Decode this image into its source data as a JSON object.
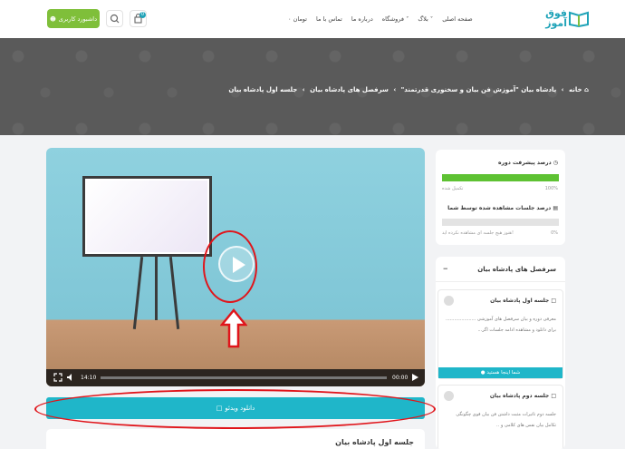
{
  "header": {
    "logo_text": "فوق آموز",
    "nav": [
      "صفحه اصلی",
      "بلاگ ˅",
      "فروشگاه ˅",
      "درباره ما",
      "تماس با ما",
      "۰ تومان"
    ],
    "dashboard_label": "داشبورد کاربری",
    "cart_count": "0"
  },
  "breadcrumb": {
    "items": [
      "خانه",
      "پادشاه بیان \"آموزش فن بیان و سخنوری قدرتمند\"",
      "سرفصل های پادشاه بیان",
      "جلسه اول پادشاه بیان"
    ],
    "separator": "›"
  },
  "video": {
    "current_time": "14:10",
    "end_time": "00:00"
  },
  "download_label": "دانلود ویدئو",
  "lesson_title": "جلسه اول پادشاه بیان",
  "progress": {
    "course_label": "درصد پیشرفت دوره",
    "course_percent": "100%",
    "course_fraction": 1.0,
    "course_status": "تکمیل شده",
    "sessions_label": "درصد جلسات مشاهده شده توسط شما",
    "sessions_percent": "0%",
    "sessions_fraction": 0.0,
    "sessions_status": "هنوز هیچ جلسه ای مشاهده نکرده اید!"
  },
  "sessions": {
    "heading": "سرفصل های پادشاه بیان",
    "items": [
      {
        "title": "جلسه اول پادشاه بیان",
        "desc": "معرفی دوره و بیان سرفصل های آموزشی ..................... برای دانلود و مشاهده ادامه جلسات اگر...",
        "cta": "شما اینجا هستید"
      },
      {
        "title": "جلسه دوم پادشاه بیان",
        "desc": "جلسه دوم تاثیرات مثبت داشتن فن بیان قوی چگونگی تکامل بیان نفس های کلامی و ..",
        "cta": ""
      }
    ]
  },
  "colors": {
    "accent": "#1fb6c9",
    "green": "#5ec233",
    "dashboard": "#7fbf3a",
    "annotation": "#e0151b"
  }
}
